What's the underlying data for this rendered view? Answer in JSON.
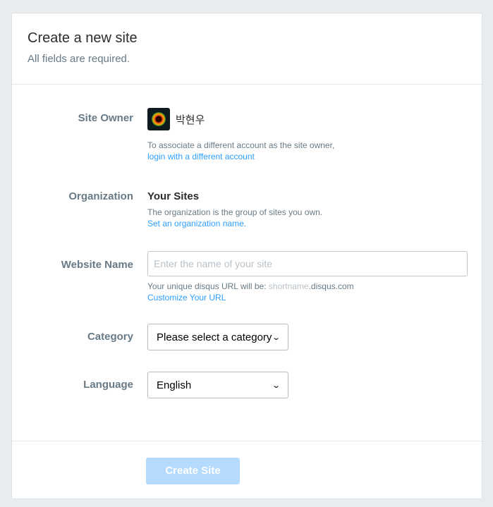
{
  "header": {
    "title": "Create a new site",
    "subtitle": "All fields are required."
  },
  "site_owner": {
    "label": "Site Owner",
    "name": "박현우",
    "avatar_icon": "avatar-ring-icon",
    "help": "To associate a different account as the site owner,",
    "link": "login with a different account"
  },
  "organization": {
    "label": "Organization",
    "name": "Your Sites",
    "help": "The organization is the group of sites you own.",
    "link": "Set an organization name."
  },
  "website_name": {
    "label": "Website Name",
    "value": "",
    "placeholder": "Enter the name of your site",
    "help_prefix": "Your unique disqus URL will be: ",
    "help_shortname": "shortname",
    "help_suffix": ".disqus.com",
    "link": "Customize Your URL"
  },
  "category": {
    "label": "Category",
    "selected": "Please select a category"
  },
  "language": {
    "label": "Language",
    "selected": "English"
  },
  "footer": {
    "create_label": "Create Site"
  },
  "colors": {
    "accent": "#2e9fff",
    "button_disabled": "#b4dbfd",
    "label": "#687a86"
  }
}
